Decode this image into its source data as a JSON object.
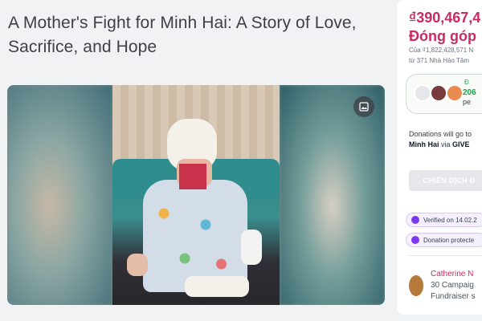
{
  "campaign": {
    "title": "A Mother's Fight for Minh Hai: A Story of Love, Sacrifice, and Hope"
  },
  "donation_card": {
    "amount": "₫390,467,4",
    "raised_label": "Đóng góp",
    "goal_line": "Của ₫1,822,428,571 N",
    "donors_line": "từ 371 Nhà Hảo Tâm",
    "donor_count": "206",
    "donor_sub": "pe",
    "donor_mini": "Đ",
    "goes_to_line1": "Donations will go to",
    "goes_to_name": "Minh Hai",
    "goes_to_via": "via",
    "goes_to_platform": "GIVE",
    "cta_label": "CHIẾN DỊCH Đ",
    "verified_chip": "Verified on 14.02.2",
    "protected_chip": "Donation protecte"
  },
  "organizer": {
    "name": "Catherine N",
    "campaigns": "30 Campaig",
    "role": "Fundraiser s"
  },
  "colors": {
    "brand": "#c92a63",
    "success": "#16a34a",
    "verified": "#7c3aed"
  },
  "icons": {
    "gallery": "gallery-icon",
    "verified": "check-badge-icon",
    "protected": "shield-icon"
  }
}
